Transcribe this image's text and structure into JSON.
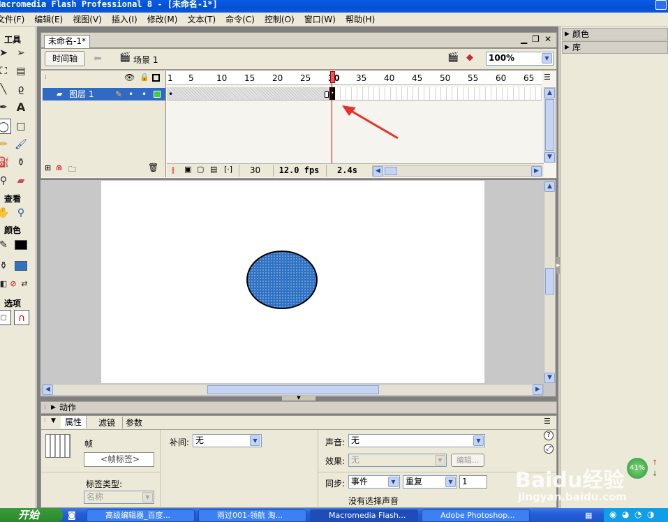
{
  "window": {
    "title": "Macromedia Flash Professional 8 - [未命名-1*]"
  },
  "menu": [
    "文件(F)",
    "编辑(E)",
    "视图(V)",
    "插入(I)",
    "修改(M)",
    "文本(T)",
    "命令(C)",
    "控制(O)",
    "窗口(W)",
    "帮助(H)"
  ],
  "tools": {
    "title": "工具",
    "view_label": "查看",
    "colors_label": "颜色",
    "options_label": "选项"
  },
  "document": {
    "tab": "未命名-1*",
    "timeline_button": "时间轴",
    "scene": "场景 1",
    "zoom": "100%"
  },
  "timeline": {
    "layer_name": "图层 1",
    "ruler": [
      "1",
      "5",
      "10",
      "15",
      "20",
      "25",
      "30",
      "35",
      "40",
      "45",
      "50",
      "55",
      "60",
      "65"
    ],
    "current_frame": "30",
    "fps": "12.0 fps",
    "time": "2.4s"
  },
  "panels": {
    "actions": "动作",
    "tabs": [
      "属性",
      "滤镜",
      "参数"
    ],
    "color": "颜色",
    "library": "库"
  },
  "properties": {
    "frame_label": "帧",
    "frame_name_placeholder": "<帧标签>",
    "label_type": "标签类型:",
    "label_type_value": "名称",
    "tween_label": "补间:",
    "tween_value": "无",
    "sound_label": "声音:",
    "sound_value": "无",
    "effect_label": "效果:",
    "effect_value": "无",
    "edit_button": "编辑...",
    "sync_label": "同步:",
    "sync_value": "事件",
    "repeat_value": "重复",
    "repeat_count": "1",
    "no_sound": "没有选择声音"
  },
  "taskbar": {
    "start": "开始",
    "tasks": [
      "高级编辑器_百度...",
      "雨过001-领航 淘...",
      "Macromedia Flash...",
      "Adobe Photoshop..."
    ]
  },
  "tray": {
    "gauge": "41%"
  },
  "watermark": {
    "brand": "Baidu经验",
    "url": "jingyan.baidu.com"
  }
}
